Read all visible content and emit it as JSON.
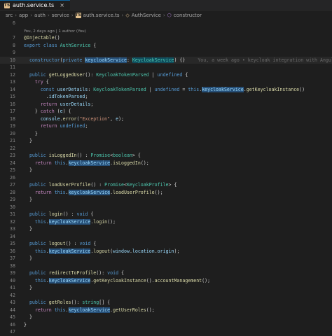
{
  "tab": {
    "badge": "TS",
    "name": "auth.service.ts",
    "close": "×"
  },
  "breadcrumb": [
    "src",
    "app",
    "auth",
    "service",
    "auth.service.ts",
    "AuthService",
    "constructor"
  ],
  "codelens": "You, 2 days ago | 1 author (You)",
  "blame": "You, a week ago • keycloak integration with Angular",
  "lines": [
    {
      "n": "6",
      "html": ""
    },
    {
      "n": "",
      "html": "<span class='lens'>You, 2 days ago | 1 author (You)</span>"
    },
    {
      "n": "7",
      "html": "<span class='dec'>@Injectable</span>()"
    },
    {
      "n": "8",
      "html": "<span class='kw'>export</span> <span class='kw'>class</span> <span class='ty'>AuthService</span> {"
    },
    {
      "n": "9",
      "html": ""
    },
    {
      "n": "10",
      "cur": true,
      "html": "  <span class='kw'>constructor</span>(<span class='kw'>private</span> <span class='pr hl'>keycloakService</span>: <span class='hl2'>KeycloakService</span>) {}"
    },
    {
      "n": "11",
      "html": ""
    },
    {
      "n": "12",
      "html": "  <span class='kw'>public</span> <span class='fn'>getLoggedUser</span>(): <span class='ty'>KeycloakTokenParsed</span> | <span class='kw'>undefined</span> {"
    },
    {
      "n": "13",
      "html": "    <span class='kw2'>try</span> {"
    },
    {
      "n": "14",
      "html": "      <span class='kw'>const</span> <span class='pr'>userDetails</span>: <span class='ty'>KeycloakTokenParsed</span> | <span class='kw'>undefined</span> = <span class='kw'>this</span>.<span class='pr hl'>keycloakService</span>.<span class='fn'>getKeycloakInstance</span>()"
    },
    {
      "n": "15",
      "html": "        .<span class='pr'>idTokenParsed</span>;"
    },
    {
      "n": "16",
      "html": "      <span class='kw2'>return</span> <span class='pr'>userDetails</span>;"
    },
    {
      "n": "17",
      "html": "    } <span class='kw2'>catch</span> (<span class='pr'>e</span>) {"
    },
    {
      "n": "18",
      "html": "      <span class='pr'>console</span>.<span class='fn'>error</span>(<span class='str'>\"Exception\"</span>, <span class='pr'>e</span>);"
    },
    {
      "n": "19",
      "html": "      <span class='kw2'>return</span> <span class='kw'>undefined</span>;"
    },
    {
      "n": "20",
      "html": "    }"
    },
    {
      "n": "21",
      "html": "  }"
    },
    {
      "n": "22",
      "html": ""
    },
    {
      "n": "23",
      "html": "  <span class='kw'>public</span> <span class='fn'>isLoggedIn</span>() : <span class='ty'>Promise</span>&lt;<span class='ty'>boolean</span>&gt; {"
    },
    {
      "n": "24",
      "html": "    <span class='kw2'>return</span> <span class='kw'>this</span>.<span class='pr hl'>keycloakService</span>.<span class='fn'>isLoggedIn</span>();"
    },
    {
      "n": "25",
      "html": "  }"
    },
    {
      "n": "26",
      "html": ""
    },
    {
      "n": "27",
      "html": "  <span class='kw'>public</span> <span class='fn'>loadUserProfile</span>() : <span class='ty'>Promise</span>&lt;<span class='ty'>KeycloakProfile</span>&gt; {"
    },
    {
      "n": "28",
      "html": "    <span class='kw2'>return</span> <span class='kw'>this</span>.<span class='pr hl'>keycloakService</span>.<span class='fn'>loadUserProfile</span>();"
    },
    {
      "n": "29",
      "html": "  }"
    },
    {
      "n": "30",
      "html": ""
    },
    {
      "n": "31",
      "html": "  <span class='kw'>public</span> <span class='fn'>login</span>() : <span class='kw'>void</span> {"
    },
    {
      "n": "32",
      "html": "    <span class='kw'>this</span>.<span class='pr hl'>keycloakService</span>.<span class='fn'>login</span>();"
    },
    {
      "n": "33",
      "html": "  }"
    },
    {
      "n": "34",
      "html": ""
    },
    {
      "n": "35",
      "html": "  <span class='kw'>public</span> <span class='fn'>logout</span>() : <span class='kw'>void</span> {"
    },
    {
      "n": "36",
      "html": "    <span class='kw'>this</span>.<span class='pr hl'>keycloakService</span>.<span class='fn'>logout</span>(<span class='pr'>window</span>.<span class='pr'>location</span>.<span class='pr'>origin</span>);"
    },
    {
      "n": "37",
      "html": "  }"
    },
    {
      "n": "38",
      "html": ""
    },
    {
      "n": "39",
      "html": "  <span class='kw'>public</span> <span class='fn'>redirectToProfile</span>(): <span class='kw'>void</span> {"
    },
    {
      "n": "40",
      "html": "    <span class='kw'>this</span>.<span class='pr hl'>keycloakService</span>.<span class='fn'>getKeycloakInstance</span>().<span class='fn'>accountManagement</span>();"
    },
    {
      "n": "41",
      "html": "  }"
    },
    {
      "n": "42",
      "html": ""
    },
    {
      "n": "43",
      "html": "  <span class='kw'>public</span> <span class='fn'>getRoles</span>(): <span class='ty'>string</span>[] {"
    },
    {
      "n": "44",
      "html": "    <span class='kw2'>return</span> <span class='kw'>this</span>.<span class='pr hl'>keycloakService</span>.<span class='fn'>getUserRoles</span>();"
    },
    {
      "n": "45",
      "html": "  }"
    },
    {
      "n": "46",
      "html": "}"
    },
    {
      "n": "47",
      "html": ""
    }
  ]
}
